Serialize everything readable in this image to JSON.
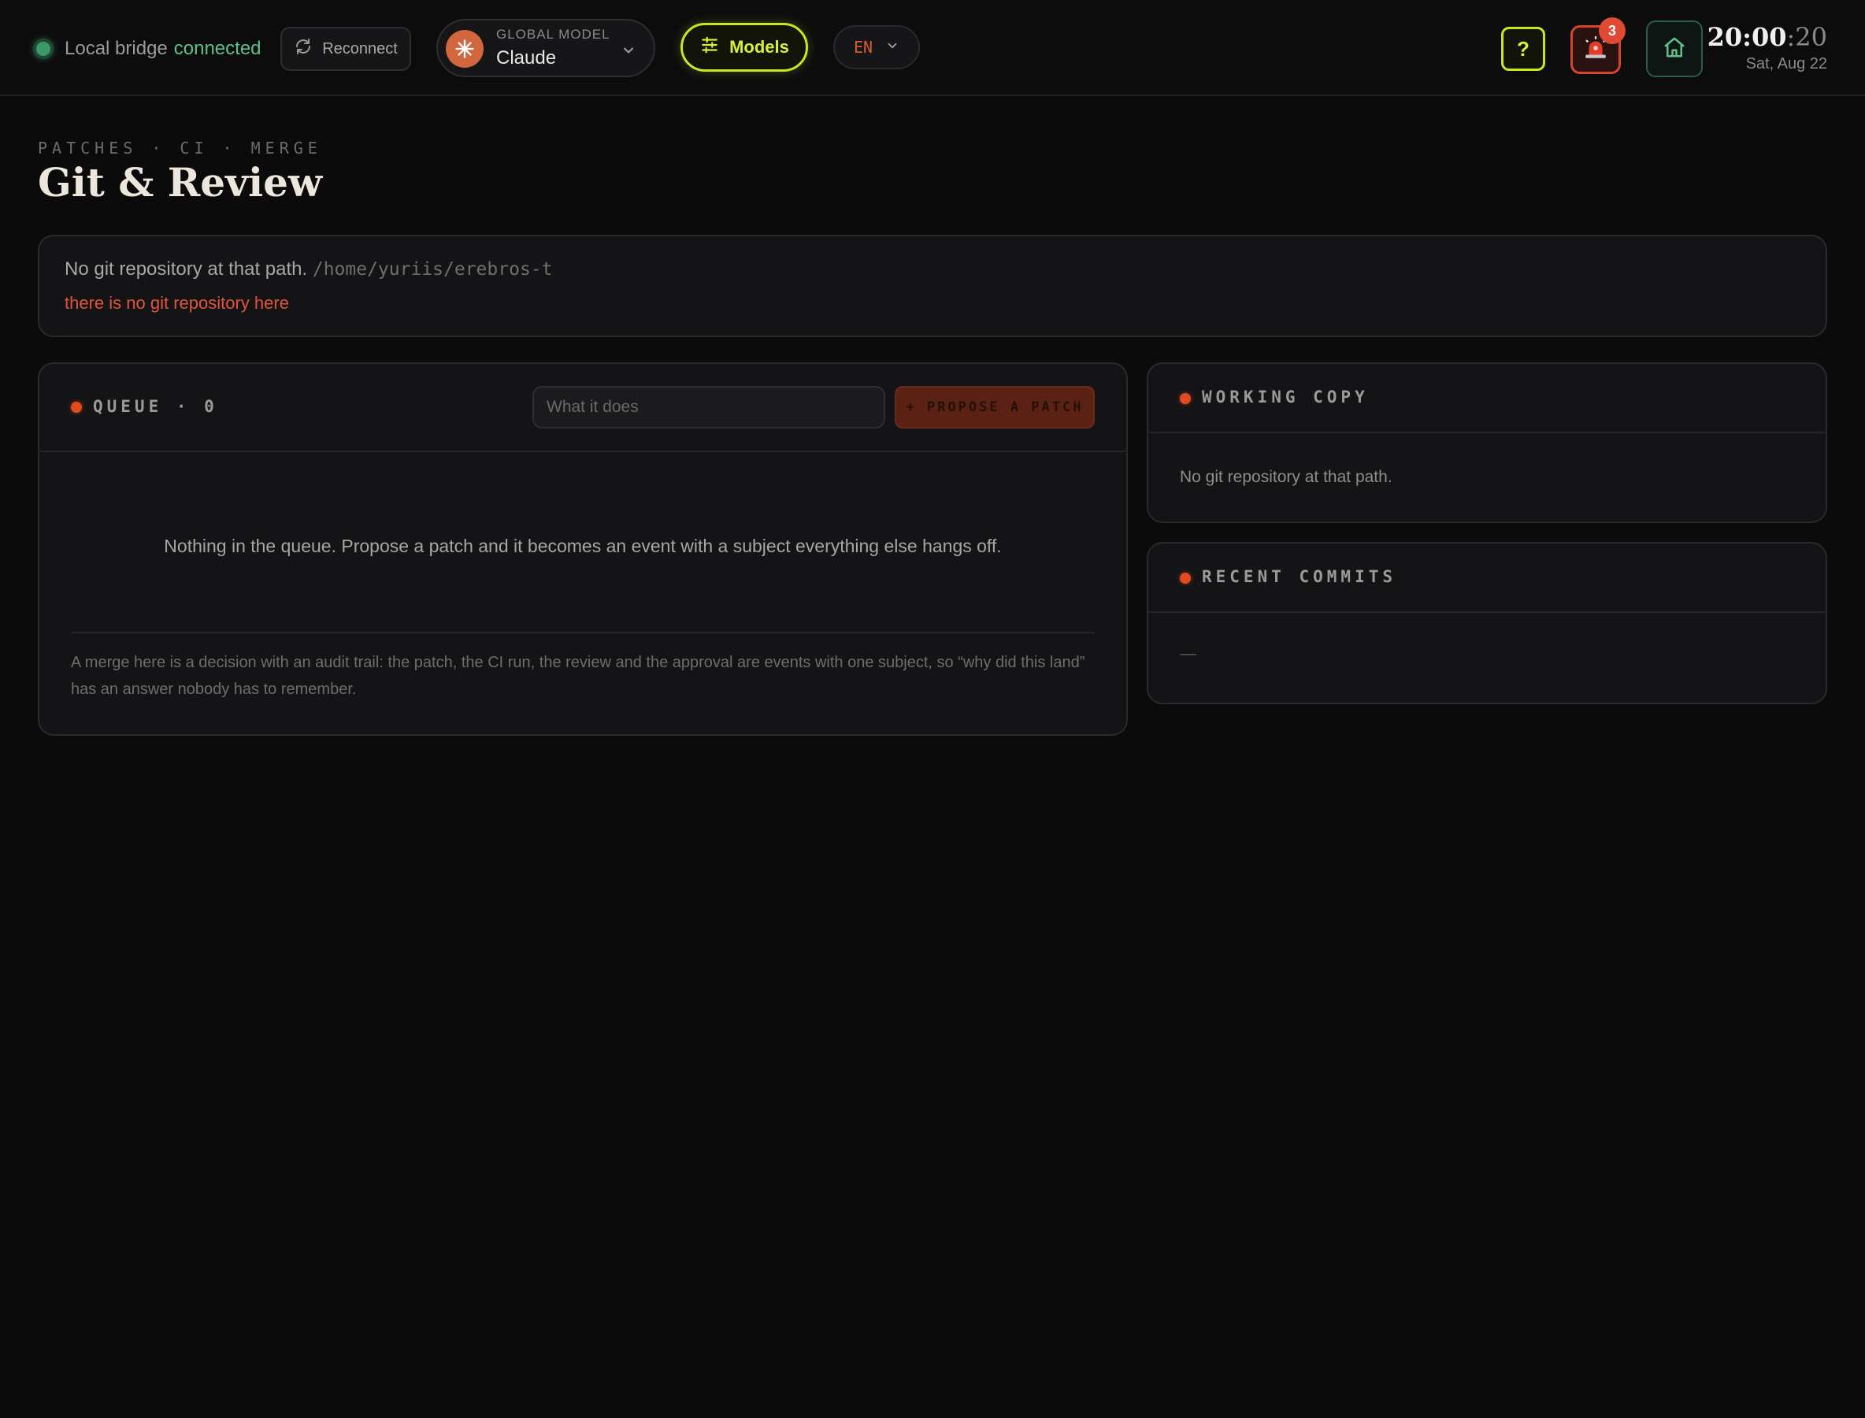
{
  "topbar": {
    "bridge_label": "Local bridge",
    "bridge_status": "connected",
    "reconnect_label": "Reconnect",
    "model_kicker": "GLOBAL MODEL",
    "model_name": "Claude",
    "models_label": "Models",
    "language": "EN",
    "help_label": "?",
    "alert_count": "3",
    "clock_hm": "20:00",
    "clock_sec": ":20",
    "date": "Sat, Aug 22"
  },
  "page": {
    "kicker": "PATCHES · CI · MERGE",
    "title": "Git & Review"
  },
  "banner": {
    "message": "No git repository at that path.",
    "path": "/home/yuriis/erebros-t",
    "error": "there is no git repository here"
  },
  "queue": {
    "title": "QUEUE · 0",
    "input_placeholder": "What it does",
    "propose_label": "+ PROPOSE A PATCH",
    "empty_message": "Nothing in the queue. Propose a patch and it becomes an event with a subject everything else hangs off.",
    "note": "A merge here is a decision with an audit trail: the patch, the CI run, the review and the approval are events with one subject, so “why did this land” has an answer nobody has to remember."
  },
  "working_copy": {
    "title": "WORKING COPY",
    "message": "No git repository at that path."
  },
  "recent_commits": {
    "title": "RECENT COMMITS",
    "placeholder": "—"
  },
  "colors": {
    "accent_lime": "#c9e61e",
    "accent_orange": "#e24b22",
    "status_green": "#5ec08c",
    "error_red": "#e0553a"
  },
  "icons": [
    "status-dot-icon",
    "refresh-icon",
    "asterisk-icon",
    "chevron-down-icon",
    "sliders-icon",
    "siren-icon",
    "home-icon"
  ]
}
